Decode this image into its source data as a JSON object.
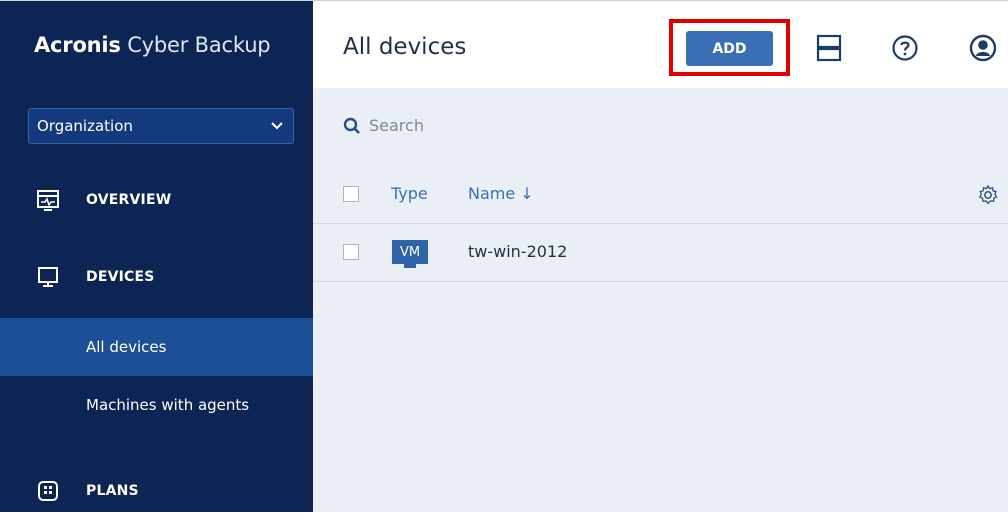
{
  "app": {
    "brand_bold": "Acronis",
    "brand_light": " Cyber Backup"
  },
  "sidebar": {
    "org_selector": {
      "value": "Organization",
      "icon": "chevron-down-icon"
    },
    "items": [
      {
        "label": "OVERVIEW",
        "icon": "overview-monitor-icon"
      },
      {
        "label": "DEVICES",
        "icon": "devices-monitor-icon"
      },
      {
        "label": "PLANS",
        "icon": "plans-icon"
      }
    ],
    "sub_items": [
      {
        "label": "All devices",
        "active": true
      },
      {
        "label": "Machines with agents",
        "active": false
      }
    ]
  },
  "header": {
    "title": "All devices",
    "add_label": "ADD",
    "icons": [
      "layout-toggle-icon",
      "help-icon",
      "user-account-icon"
    ]
  },
  "search": {
    "placeholder": "Search",
    "icon": "search-icon"
  },
  "table": {
    "columns": [
      {
        "label": "Type"
      },
      {
        "label": "Name ↓"
      }
    ],
    "settings_icon": "gear-icon",
    "rows": [
      {
        "type": "VM",
        "name": "tw-win-2012"
      }
    ]
  },
  "colors": {
    "sidebar_bg": "#0c2554",
    "sidebar_active": "#1d4f96",
    "accent": "#3a6fb5",
    "highlight": "#e00000",
    "content_bg": "#eaeff5"
  }
}
